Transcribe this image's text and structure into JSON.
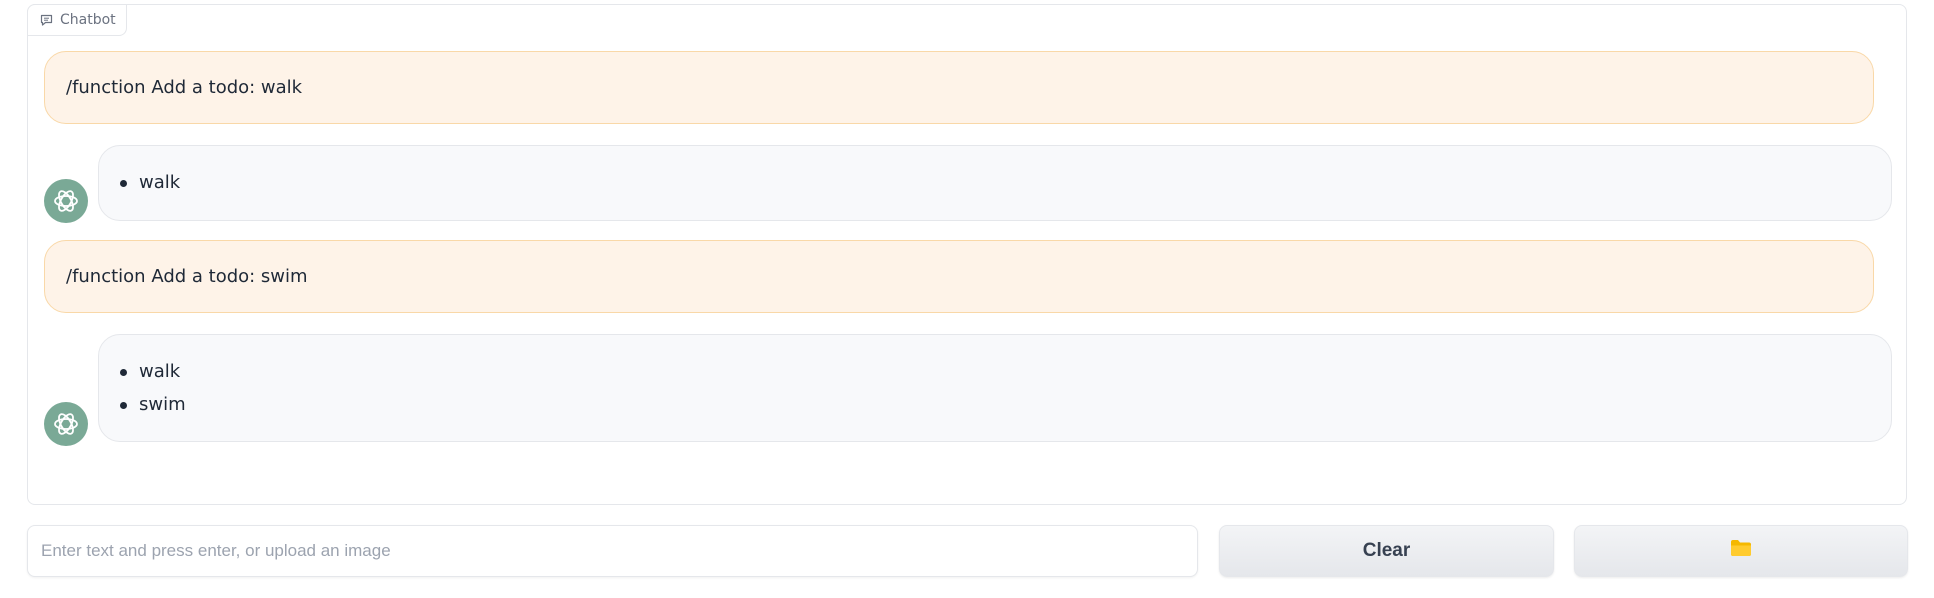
{
  "chatbot": {
    "label": "Chatbot",
    "label_icon": "chat-bubble-icon",
    "messages": [
      {
        "role": "user",
        "text": "/function Add a todo: walk"
      },
      {
        "role": "bot",
        "avatar_icon": "openai-logo-icon",
        "items": [
          "walk"
        ]
      },
      {
        "role": "user",
        "text": "/function Add a todo: swim"
      },
      {
        "role": "bot",
        "avatar_icon": "openai-logo-icon",
        "items": [
          "walk",
          "swim"
        ]
      }
    ]
  },
  "input": {
    "placeholder": "Enter text and press enter, or upload an image",
    "value": ""
  },
  "buttons": {
    "clear_label": "Clear",
    "upload_icon": "folder-icon"
  },
  "colors": {
    "user_bubble_bg": "#fef3e8",
    "user_bubble_border": "#f9d8a8",
    "bot_bubble_bg": "#f8f9fb",
    "avatar_bg": "#7aa996",
    "folder_icon": "#f5b800"
  }
}
